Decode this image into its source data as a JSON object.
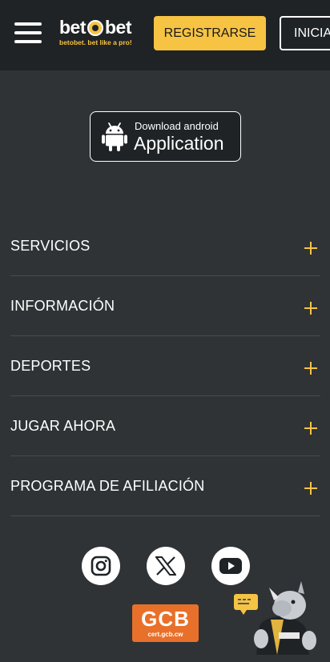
{
  "header": {
    "logo": {
      "left": "bet",
      "right": "bet",
      "tagline": "betobet. bet like a pro!"
    },
    "register_label": "REGISTRARSE",
    "login_label": "INICIAR"
  },
  "download": {
    "small_text": "Download android",
    "big_text": "Application",
    "icon": "android-icon"
  },
  "menu": {
    "items": [
      {
        "label": "SERVICIOS"
      },
      {
        "label": "INFORMACIÓN"
      },
      {
        "label": "DEPORTES"
      },
      {
        "label": "JUGAR AHORA"
      },
      {
        "label": "PROGRAMA DE AFILIACIÓN"
      }
    ],
    "expand_icon": "plus-icon"
  },
  "social": [
    "instagram-icon",
    "x-icon",
    "youtube-icon"
  ],
  "badge": {
    "title": "GCB",
    "subtitle": "cert.gcb.cw"
  },
  "colors": {
    "background": "#2f3336",
    "header": "#1f2326",
    "accent": "#f6c343",
    "badge": "#e8702a"
  }
}
